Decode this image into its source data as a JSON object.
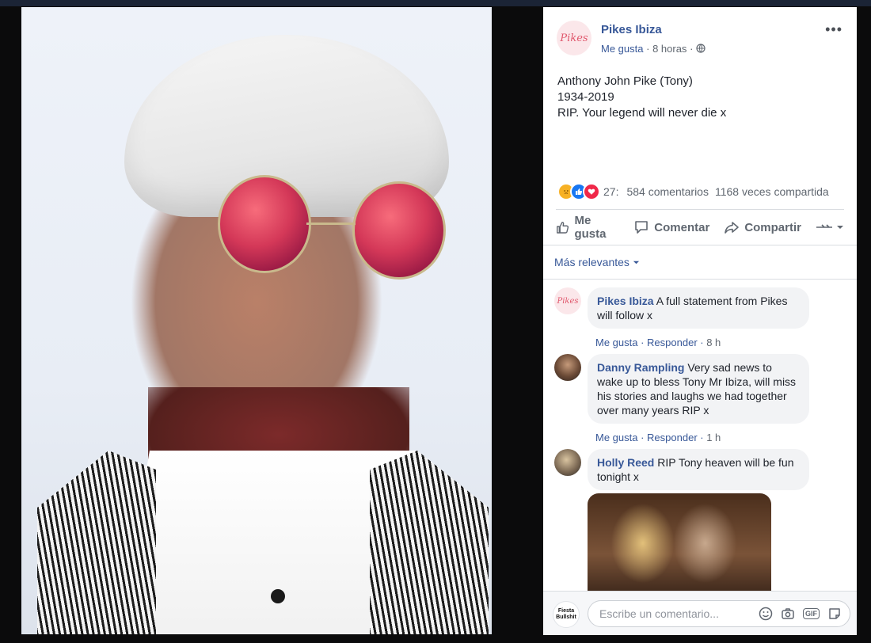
{
  "post": {
    "page_name": "Pikes Ibiza",
    "logo_text": "Pikes",
    "meta_like": "Me gusta",
    "meta_time": "8 horas",
    "more": "•••",
    "lines": [
      "Anthony John Pike (Tony)",
      "1934-2019",
      "RIP. Your legend will never die x"
    ]
  },
  "stats": {
    "reactions": "27:",
    "comments": "584 comentarios",
    "shares": "1168 veces compartida"
  },
  "actions": {
    "like": "Me gusta",
    "comment": "Comentar",
    "share": "Compartir"
  },
  "relevance": "Más relevantes",
  "comments": [
    {
      "name": "Pikes Ibiza",
      "text": "A full statement from Pikes will follow x",
      "like": "Me gusta",
      "reply": "Responder",
      "time": "8 h"
    },
    {
      "name": "Danny Rampling",
      "text": "Very sad news to wake up to bless Tony Mr Ibiza, will miss his stories and laughs we had together over many years RIP x",
      "like": "Me gusta",
      "reply": "Responder",
      "time": "1 h"
    },
    {
      "name": "Holly Reed",
      "text": "RIP Tony heaven will be fun tonight x"
    }
  ],
  "composer": {
    "placeholder": "Escribe un comentario...",
    "avatar_text": "Fiesta Bullshit",
    "gif": "GIF"
  },
  "colors": {
    "link": "#385898",
    "accent": "#1877f2"
  }
}
